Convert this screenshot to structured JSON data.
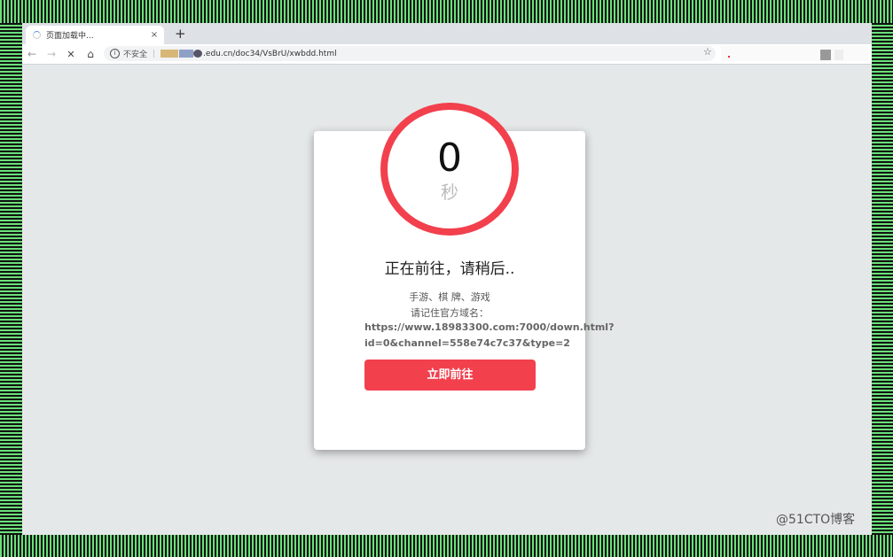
{
  "browser": {
    "tab_title": "页面加载中...",
    "tab_close": "×",
    "new_tab": "+",
    "insecure_label": "不安全",
    "url_visible": ".edu.cn/doc34/VsBrU/xwbdd.html"
  },
  "page": {
    "countdown_value": "0",
    "countdown_unit": "秒",
    "heading": "正在前往，请稍后..",
    "categories": "手游、棋 牌、游戏",
    "remember_label": "请记住官方域名：",
    "url_line1": "https://www.18983300.com:7000/down.html?",
    "url_line2": "id=0&channel=558e74c7c37&type=2",
    "go_button": "立即前往"
  },
  "watermark": "@51CTO博客",
  "colors": {
    "accent_red": "#f2404d",
    "background": "#e5e8e9",
    "border_stripes": "#6be07a"
  }
}
